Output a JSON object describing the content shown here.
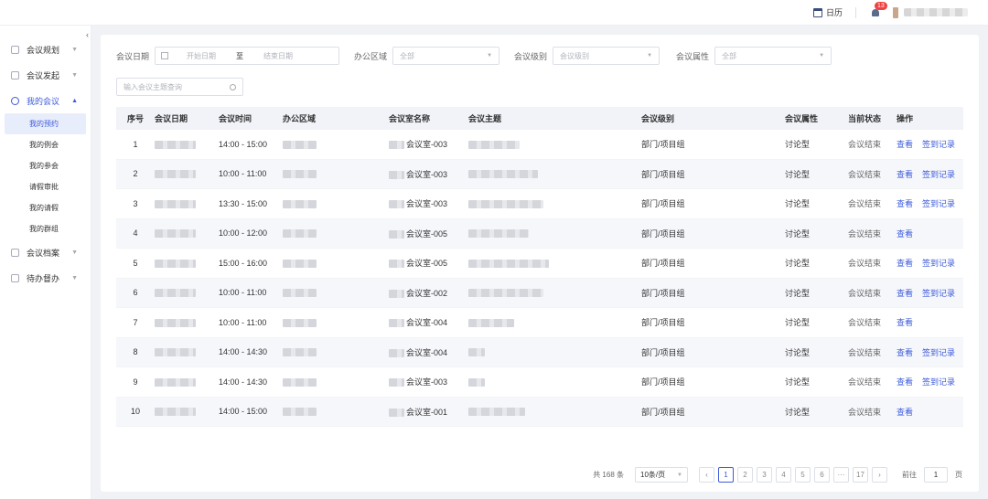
{
  "topbar": {
    "calendar_label": "日历",
    "notification_count": "13"
  },
  "sidebar": {
    "collapse_glyph": "‹",
    "items": [
      {
        "label": "会议规划",
        "open": false
      },
      {
        "label": "会议发起",
        "open": false
      },
      {
        "label": "我的会议",
        "open": true
      },
      {
        "label": "会议档案",
        "open": false
      },
      {
        "label": "待办督办",
        "open": false
      }
    ],
    "sub_items": [
      {
        "label": "我的预约",
        "active": true
      },
      {
        "label": "我的例会",
        "active": false
      },
      {
        "label": "我的参会",
        "active": false
      },
      {
        "label": "请假审批",
        "active": false
      },
      {
        "label": "我的请假",
        "active": false
      },
      {
        "label": "我的群组",
        "active": false
      }
    ]
  },
  "filters": {
    "date_label": "会议日期",
    "date_start_placeholder": "开始日期",
    "date_sep": "至",
    "date_end_placeholder": "结束日期",
    "area_label": "办公区域",
    "area_value": "全部",
    "level_label": "会议级别",
    "level_placeholder": "会议级别",
    "attr_label": "会议属性",
    "attr_value": "全部",
    "search_placeholder": "输入会议主题查询"
  },
  "table": {
    "headers": [
      "序号",
      "会议日期",
      "会议时间",
      "办公区域",
      "会议室名称",
      "会议主题",
      "会议级别",
      "会议属性",
      "当前状态",
      "操作"
    ],
    "view_label": "查看",
    "signin_label": "签到记录",
    "rows": [
      {
        "no": "1",
        "time": "14:00 - 15:00",
        "room": "会议室-003",
        "level": "部门/项目组",
        "attr": "讨论型",
        "status": "会议结束",
        "has_signin": true,
        "topic_w": 56
      },
      {
        "no": "2",
        "time": "10:00 - 11:00",
        "room": "会议室-003",
        "level": "部门/项目组",
        "attr": "讨论型",
        "status": "会议结束",
        "has_signin": true,
        "topic_w": 76
      },
      {
        "no": "3",
        "time": "13:30 - 15:00",
        "room": "会议室-003",
        "level": "部门/项目组",
        "attr": "讨论型",
        "status": "会议结束",
        "has_signin": true,
        "topic_w": 82
      },
      {
        "no": "4",
        "time": "10:00 - 12:00",
        "room": "会议室-005",
        "level": "部门/项目组",
        "attr": "讨论型",
        "status": "会议结束",
        "has_signin": false,
        "topic_w": 66
      },
      {
        "no": "5",
        "time": "15:00 - 16:00",
        "room": "会议室-005",
        "level": "部门/项目组",
        "attr": "讨论型",
        "status": "会议结束",
        "has_signin": true,
        "topic_w": 88
      },
      {
        "no": "6",
        "time": "10:00 - 11:00",
        "room": "会议室-002",
        "level": "部门/项目组",
        "attr": "讨论型",
        "status": "会议结束",
        "has_signin": true,
        "topic_w": 82
      },
      {
        "no": "7",
        "time": "10:00 - 11:00",
        "room": "会议室-004",
        "level": "部门/项目组",
        "attr": "讨论型",
        "status": "会议结束",
        "has_signin": false,
        "topic_w": 50
      },
      {
        "no": "8",
        "time": "14:00 - 14:30",
        "room": "会议室-004",
        "level": "部门/项目组",
        "attr": "讨论型",
        "status": "会议结束",
        "has_signin": true,
        "topic_w": 18
      },
      {
        "no": "9",
        "time": "14:00 - 14:30",
        "room": "会议室-003",
        "level": "部门/项目组",
        "attr": "讨论型",
        "status": "会议结束",
        "has_signin": true,
        "topic_w": 18
      },
      {
        "no": "10",
        "time": "14:00 - 15:00",
        "room": "会议室-001",
        "level": "部门/项目组",
        "attr": "讨论型",
        "status": "会议结束",
        "has_signin": false,
        "topic_w": 62
      }
    ]
  },
  "pagination": {
    "total": "共 168 条",
    "page_size": "10条/页",
    "prev": "‹",
    "next": "›",
    "pages": [
      "1",
      "2",
      "3",
      "4",
      "5",
      "6",
      "···",
      "17"
    ],
    "current": "1",
    "goto_label": "前往",
    "goto_value": "1",
    "page_unit": "页"
  }
}
